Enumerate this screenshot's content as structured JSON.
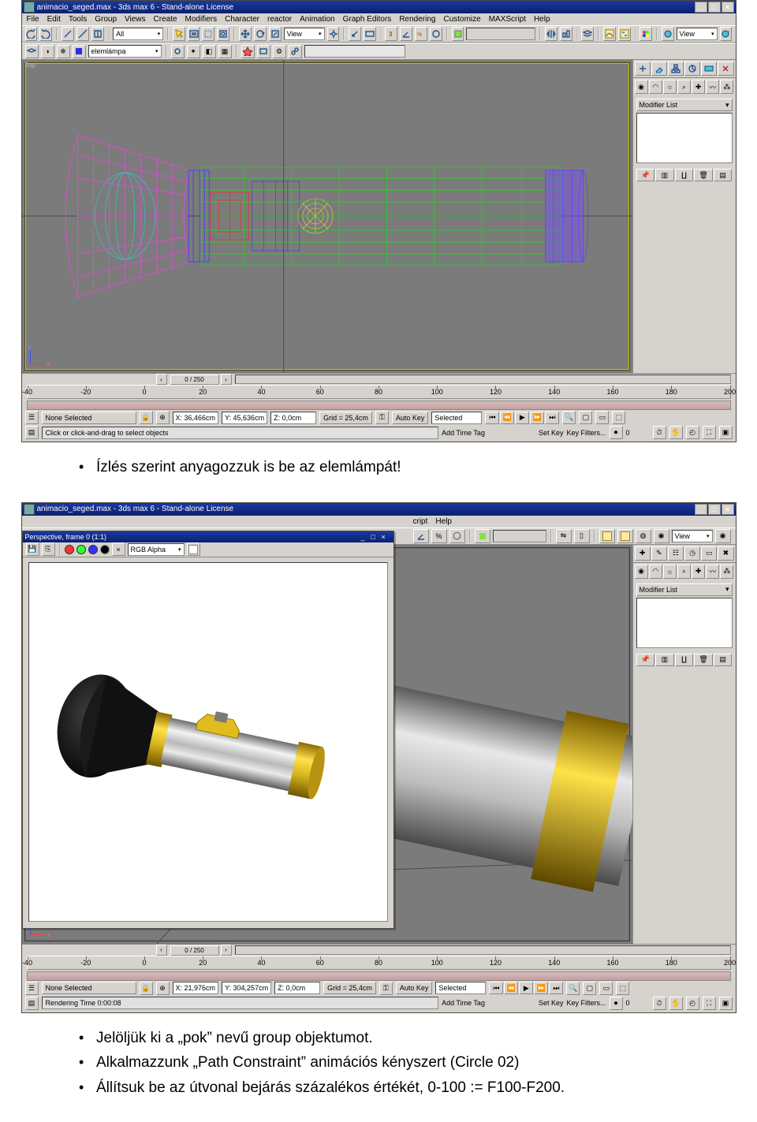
{
  "app": {
    "title": "animacio_seged.max - 3ds max 6 - Stand-alone License",
    "menus": [
      "File",
      "Edit",
      "Tools",
      "Group",
      "Views",
      "Create",
      "Modifiers",
      "Character",
      "reactor",
      "Animation",
      "Graph Editors",
      "Rendering",
      "Customize",
      "MAXScript",
      "Help"
    ],
    "menus2": [
      "cript",
      "Help"
    ]
  },
  "toolbar1": {
    "selset": "All",
    "view": "View",
    "view_r": "View"
  },
  "toolbar2": {
    "sel_name": "elemlámpa"
  },
  "viewport1": {
    "label": "Top"
  },
  "viewport2": {
    "label": ""
  },
  "axis": {
    "z": "z",
    "x": "x"
  },
  "cmd": {
    "modifier_list": "Modifier List"
  },
  "timeline": {
    "slider": "0 / 250",
    "ticks": [
      "-40",
      "-20",
      "0",
      "20",
      "40",
      "60",
      "80",
      "100",
      "120",
      "140",
      "160",
      "180",
      "200"
    ]
  },
  "status": {
    "selection": "None Selected",
    "x1": "X: 36,466cm",
    "y1": "Y: 45,636cm",
    "z1": "Z: 0,0cm",
    "x2": "X: 21,976cm",
    "y2": "Y: 304,257cm",
    "z2": "Z: 0,0cm",
    "grid": "Grid = 25,4cm",
    "autokey": "Auto Key",
    "keymode": "Selected",
    "setkey": "Set Key",
    "keyfilters": "Key Filters...",
    "frame": "0",
    "prompt1": "Click or click-and-drag to select objects",
    "prompt2": "Rendering Time  0:00:08",
    "addtag": "Add Time Tag"
  },
  "render": {
    "title": "Perspective, frame 0 (1:1)",
    "alpha": "RGB Alpha"
  },
  "text": {
    "b1": "Ízlés szerint anyagozzuk is be az elemlámpát!",
    "b2": "Jelöljük ki a „pok” nevű group objektumot.",
    "b3": "Alkalmazzunk „Path Constraint” animációs kényszert (Circle 02)",
    "b4": "Állítsuk be az útvonal bejárás százalékos értékét, 0-100 := F100-F200."
  }
}
